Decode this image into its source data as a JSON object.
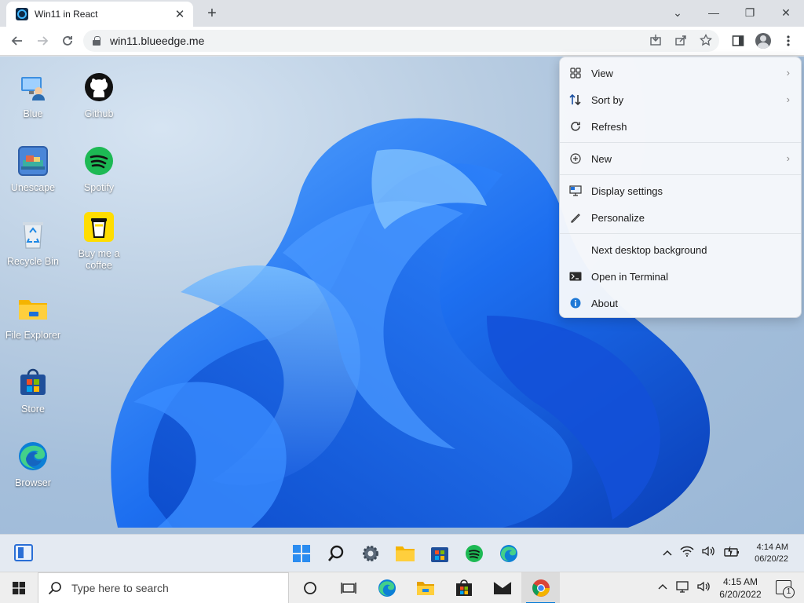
{
  "browser": {
    "tab_title": "Win11 in React",
    "new_tab_label": "+",
    "url": "win11.blueedge.me",
    "window_controls": {
      "dropdown": "⌄",
      "minimize": "—",
      "restore": "❐",
      "close": "✕"
    }
  },
  "desktop_icons": [
    {
      "label": "Blue",
      "icon": "blue-user-icon"
    },
    {
      "label": "Github",
      "icon": "github-icon"
    },
    {
      "label": "Unescape",
      "icon": "unescape-game-icon"
    },
    {
      "label": "Spotify",
      "icon": "spotify-icon"
    },
    {
      "label": "Recycle Bin",
      "icon": "recycle-bin-icon"
    },
    {
      "label": "Buy me a coffee",
      "icon": "coffee-cup-icon"
    },
    {
      "label": "File Explorer",
      "icon": "folder-icon"
    },
    {
      "label": "Store",
      "icon": "store-icon"
    },
    {
      "label": "Browser",
      "icon": "edge-icon"
    }
  ],
  "context_menu": {
    "items": [
      {
        "label": "View",
        "icon": "grid-view-icon",
        "submenu": true
      },
      {
        "label": "Sort by",
        "icon": "sort-icon",
        "submenu": true
      },
      {
        "label": "Refresh",
        "icon": "refresh-icon",
        "submenu": false
      },
      {
        "label": "New",
        "icon": "plus-circle-icon",
        "submenu": true
      },
      {
        "label": "Display settings",
        "icon": "monitor-icon",
        "submenu": false
      },
      {
        "label": "Personalize",
        "icon": "pen-icon",
        "submenu": false
      },
      {
        "label": "Next desktop background",
        "icon": "",
        "submenu": false
      },
      {
        "label": "Open in Terminal",
        "icon": "terminal-icon",
        "submenu": false
      },
      {
        "label": "About",
        "icon": "info-icon",
        "submenu": false
      }
    ]
  },
  "win11_taskbar": {
    "time": "4:14 AM",
    "date": "06/20/22",
    "apps": [
      "start-icon",
      "search-icon",
      "settings-icon",
      "file-explorer-icon",
      "store-icon",
      "spotify-icon",
      "edge-icon"
    ]
  },
  "win10_taskbar": {
    "search_placeholder": "Type here to search",
    "time": "4:15 AM",
    "date": "6/20/2022",
    "notification_count": "1"
  },
  "colors": {
    "accent": "#0067c0",
    "bloom_blue": "#1565e8",
    "spotify_green": "#1db954"
  }
}
